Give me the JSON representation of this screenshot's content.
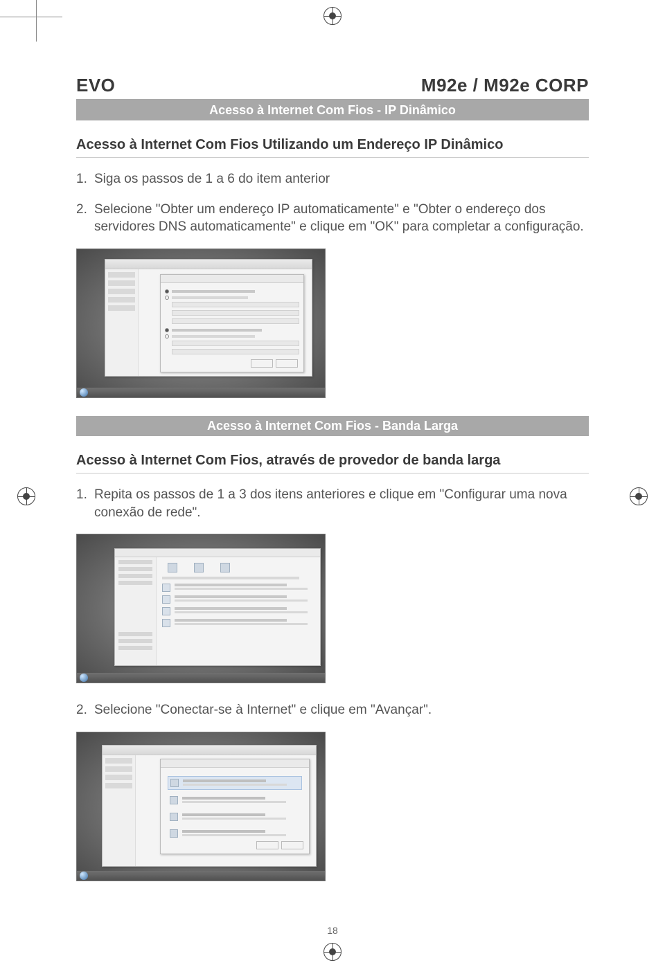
{
  "header": {
    "brand": "EVO",
    "model": "M92e / M92e CORP"
  },
  "section1": {
    "band": "Acesso à Internet Com Fios  - IP Dinâmico",
    "heading": "Acesso à Internet Com Fios Utilizando um Endereço IP Dinâmico",
    "steps": [
      "Siga os passos de 1 a 6 do item anterior",
      "Selecione \"Obter um endereço IP automaticamente\" e \"Obter o endereço dos servidores DNS automaticamente\" e clique em \"OK\" para completar a configuração."
    ]
  },
  "section2": {
    "band": "Acesso à Internet Com Fios - Banda Larga",
    "heading": "Acesso à Internet Com Fios, através de provedor de banda larga",
    "steps": [
      "Repita os passos de 1 a 3 dos itens anteriores e clique em \"Configurar uma nova conexão de rede\".",
      "Selecione \"Conectar-se à Internet\" e clique em \"Avançar\"."
    ]
  },
  "page_number": "18"
}
